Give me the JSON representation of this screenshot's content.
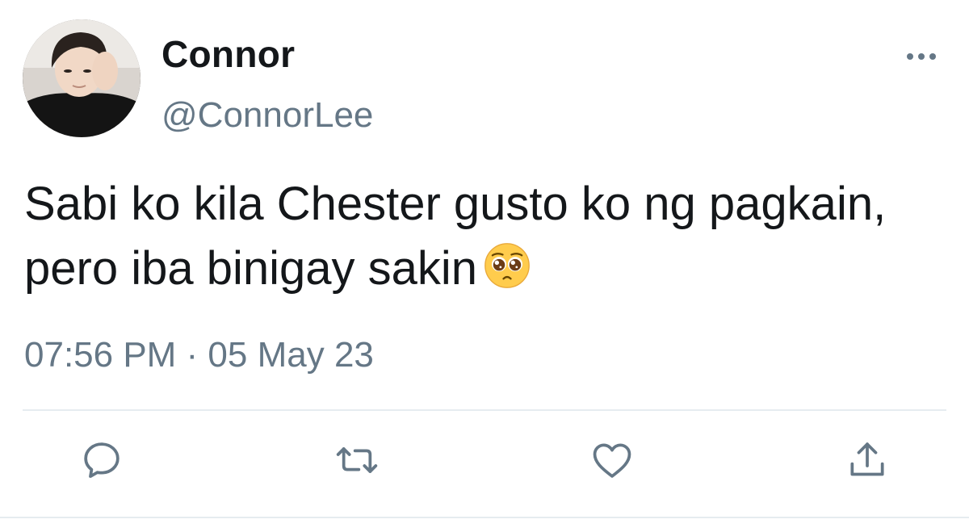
{
  "author": {
    "display_name": "Connor",
    "handle": "@ConnorLee",
    "avatar_icon": "profile-photo"
  },
  "tweet": {
    "text": "Sabi ko kila Chester gusto ko ng pagkain, pero iba binigay sakin",
    "emoji": "pleading-face-emoji",
    "timestamp": "07:56 PM · 05 May 23"
  },
  "actions": {
    "reply_icon": "speech-bubble-icon",
    "retweet_icon": "retweet-icon",
    "like_icon": "heart-icon",
    "share_icon": "share-icon",
    "more_icon": "ellipsis-icon"
  },
  "colors": {
    "text_primary": "#14171a",
    "text_secondary": "#657786",
    "icon": "#657786",
    "divider": "#e6ecf0"
  }
}
